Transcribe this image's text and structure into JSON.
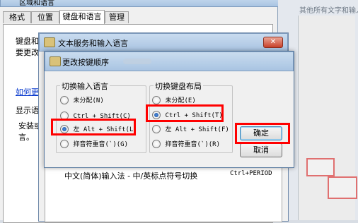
{
  "bg_window": {
    "title": "区域和语言",
    "tabs": [
      "格式",
      "位置",
      "键盘和语言",
      "管理"
    ],
    "label_keyboard": "键盘和",
    "label_change": "要更改",
    "link_how": "如何更",
    "label_display": "显示语",
    "label_install_1": "安装或",
    "label_install_2": "言。"
  },
  "right_fragments": {
    "top_text": "其他所有文字和输入"
  },
  "mid_window": {
    "title": "文本服务和输入语言",
    "hotkey_name": "中文(简体)输入法 - 中/英标点符号切换",
    "hotkey_keys": "Ctrl+PERIOD"
  },
  "dialog": {
    "title": "更改按键顺序",
    "group_left_title": "切换输入语言",
    "group_right_title": "切换键盘布局",
    "left_options": [
      {
        "label": "未分配(N)",
        "checked": false
      },
      {
        "label": "Ctrl + Shift(C)",
        "checked": false
      },
      {
        "label": "左 Alt + Shift(L)",
        "checked": true
      },
      {
        "label": "抑音符重音(`)(G)",
        "checked": false
      }
    ],
    "right_options": [
      {
        "label": "未分配(E)",
        "checked": false
      },
      {
        "label": "Ctrl + Shift(T)",
        "checked": true
      },
      {
        "label": "左 Alt + Shift(F)",
        "checked": false
      },
      {
        "label": "抑音符重音(`)(R)",
        "checked": false
      }
    ],
    "ok_label": "确定",
    "cancel_label": "取消"
  },
  "colors": {
    "highlight": "#ff0000",
    "title_bar": "#b9cfe8"
  }
}
